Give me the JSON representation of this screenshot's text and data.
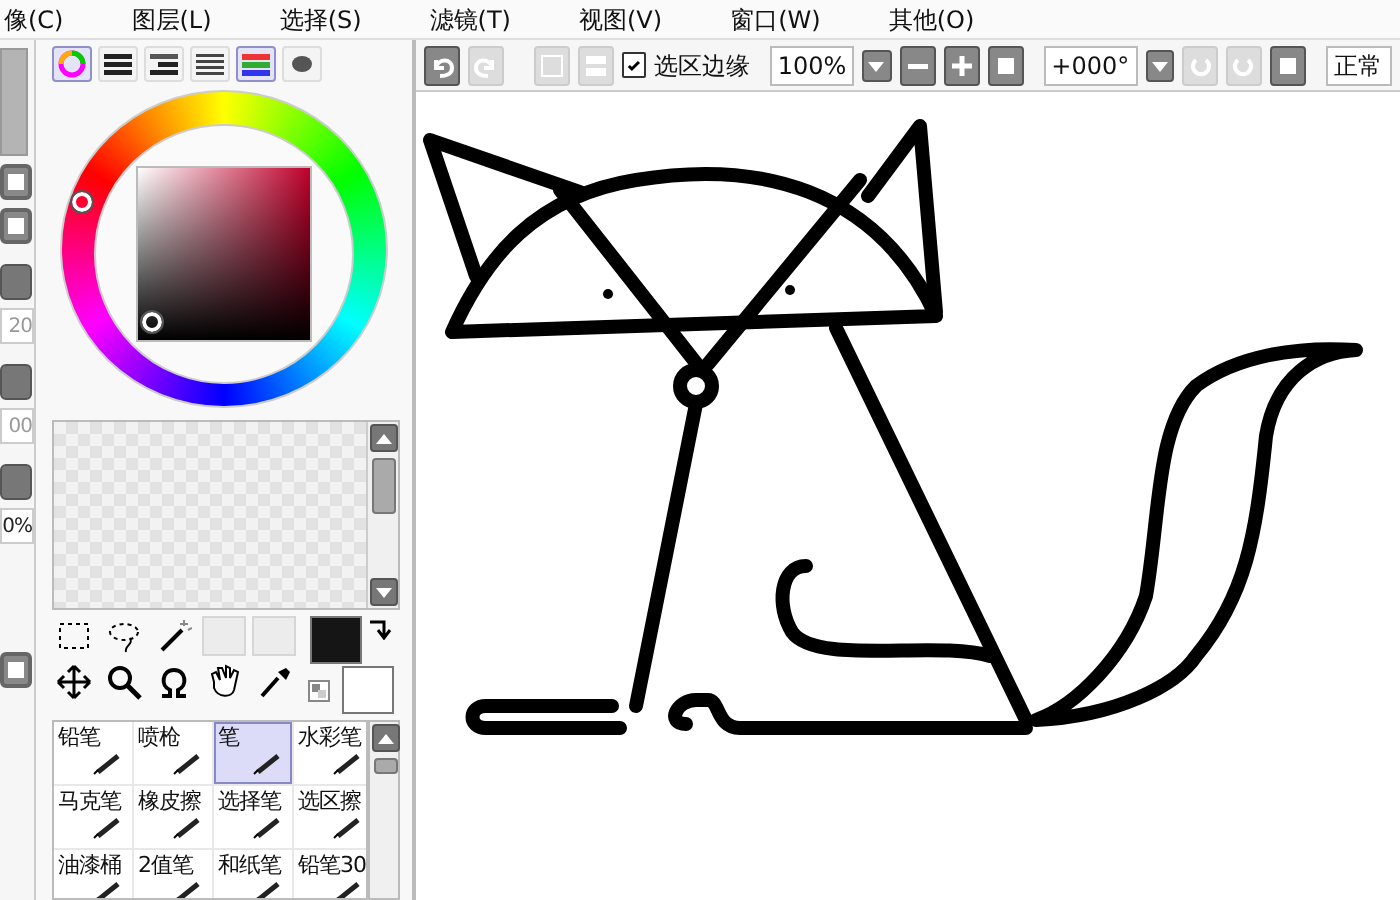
{
  "menu": [
    "像(C)",
    "图层(L)",
    "选择(S)",
    "滤镜(T)",
    "视图(V)",
    "窗口(W)",
    "其他(O)"
  ],
  "left_strip": {
    "values": [
      "20",
      "00",
      "0%"
    ]
  },
  "color_tabs": [
    {
      "selected": true
    },
    {
      "selected": false
    },
    {
      "selected": false
    },
    {
      "selected": false
    },
    {
      "selected": true
    },
    {
      "selected": false
    }
  ],
  "toolbar": {
    "selection_edge": {
      "label": "选区边缘",
      "checked": true
    },
    "zoom": "100%",
    "rotation": "+000°",
    "blend_mode": "正常"
  },
  "brushes": [
    {
      "name": "铅笔",
      "selected": false
    },
    {
      "name": "喷枪",
      "selected": false
    },
    {
      "name": "笔",
      "selected": true
    },
    {
      "name": "水彩笔",
      "selected": false
    },
    {
      "name": "马克笔",
      "selected": false
    },
    {
      "name": "橡皮擦",
      "selected": false
    },
    {
      "name": "选择笔",
      "selected": false
    },
    {
      "name": "选区擦",
      "selected": false
    },
    {
      "name": "油漆桶",
      "selected": false
    },
    {
      "name": "2值笔",
      "selected": false
    },
    {
      "name": "和纸笔",
      "selected": false
    },
    {
      "name": "铅笔30",
      "selected": false
    }
  ]
}
